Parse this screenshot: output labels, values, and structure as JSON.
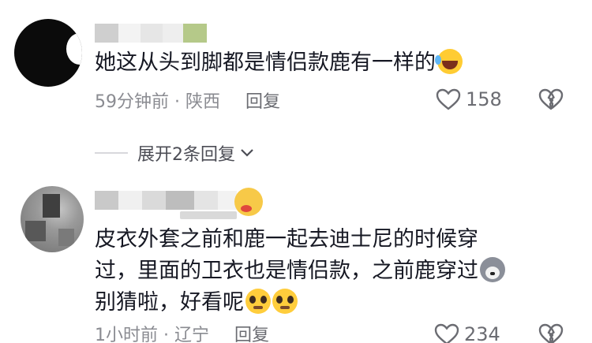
{
  "comments": [
    {
      "text": "她这从头到脚都是情侣款鹿有一样的",
      "emoji": "rolling-laugh-emoji",
      "time": "59分钟前 · 陕西",
      "reply_label": "回复",
      "like_count": "158"
    },
    {
      "text_lines": [
        "皮衣外套之前和鹿一起去迪士尼的时候穿",
        "过，里面的卫衣也是情侣款，之前鹿穿过",
        "别猜啦，好看呢"
      ],
      "emojis": [
        "husky-emoji",
        "pleading-face-emoji",
        "pleading-face-emoji"
      ],
      "time": "1小时前 · 辽宁",
      "reply_label": "回复",
      "like_count": "234"
    }
  ],
  "expand_replies_label": "展开2条回复",
  "colors": {
    "text": "#161823",
    "meta": "#8a8b91",
    "icon": "#6b6c72"
  }
}
